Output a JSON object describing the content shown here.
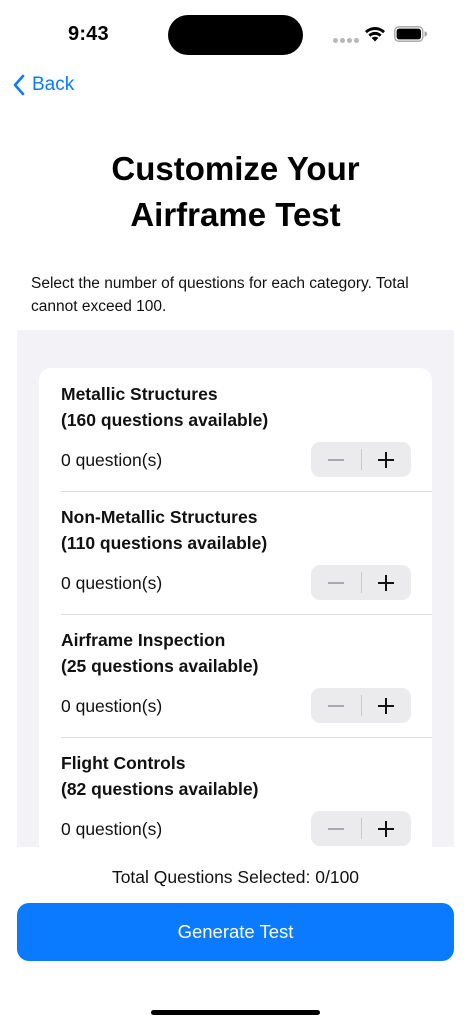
{
  "status_bar": {
    "time": "9:43",
    "icons": [
      "signal-dots-icon",
      "wifi-icon",
      "battery-icon"
    ]
  },
  "nav": {
    "back_label": "Back",
    "back_icon": "chevron-left-icon",
    "accent_color": "#0a7aff"
  },
  "header": {
    "title_line1": "Customize Your",
    "title_line2": "Airframe Test",
    "description": "Select the number of questions for each category. Total cannot exceed 100."
  },
  "categories": [
    {
      "name": "Metallic Structures",
      "available": "(160 questions available)",
      "selected": "0 question(s)"
    },
    {
      "name": "Non-Metallic Structures",
      "available": "(110 questions available)",
      "selected": "0 question(s)"
    },
    {
      "name": "Airframe Inspection",
      "available": "(25 questions available)",
      "selected": "0 question(s)"
    },
    {
      "name": "Flight Controls",
      "available": "(82 questions available)",
      "selected": "0 question(s)"
    }
  ],
  "stepper_icons": {
    "decrement": "minus-icon",
    "increment": "plus-icon"
  },
  "footer": {
    "total_label": "Total Questions Selected: 0/100",
    "generate_label": "Generate Test"
  },
  "colors": {
    "primary": "#0a7aff",
    "list_background": "#f2f2f7",
    "stepper_background": "#ebebed"
  }
}
